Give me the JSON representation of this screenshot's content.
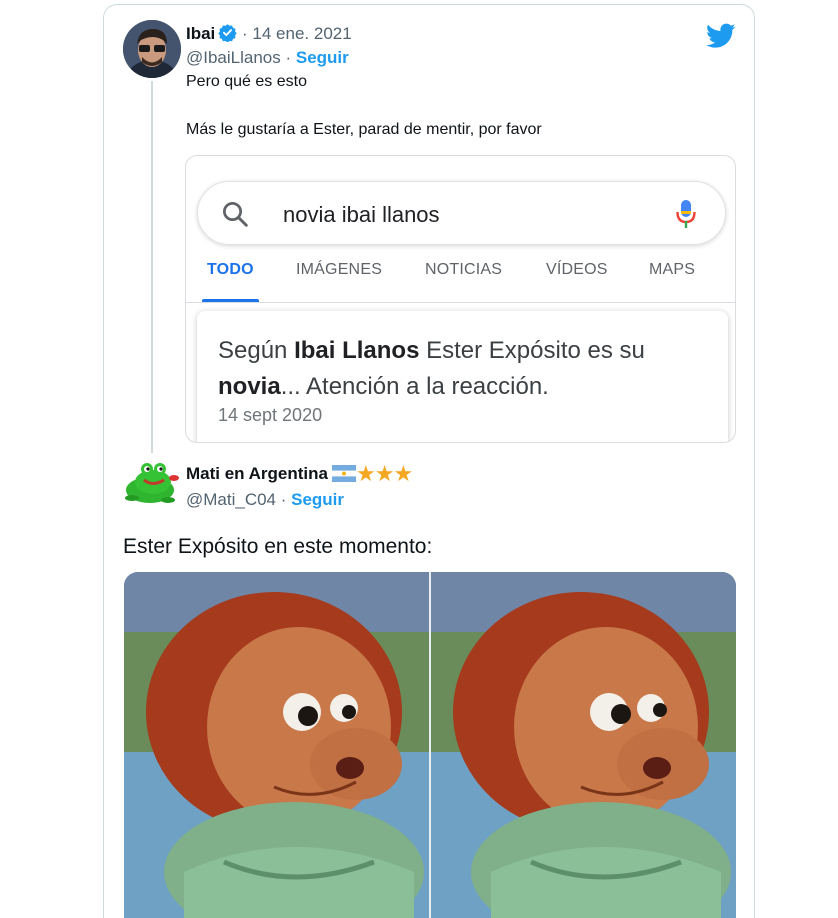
{
  "tweet": {
    "author_name": "Ibai",
    "date": "· 14 ene. 2021",
    "handle": "@IbaiLlanos",
    "separator": " · ",
    "follow_label": "Seguir",
    "text_line1": "Pero qué es esto",
    "text_line2": "Más le gustaría a Ester, parad de mentir, por favor",
    "icons": [
      "verified-icon",
      "twitter-bird-icon"
    ],
    "accent_color": "#1d9bf0"
  },
  "google": {
    "query": "novia ibai llanos",
    "tabs": [
      "TODO",
      "IMÁGENES",
      "NOTICIAS",
      "VÍDEOS",
      "MAPS"
    ],
    "active_tab": "TODO",
    "result": {
      "part1": "Según ",
      "bold1": "Ibai Llanos",
      "part2": " Ester Expósito es su",
      "bold2": "novia",
      "part3": "... Atención a la reacción.",
      "date": "14 sept 2020"
    },
    "icons": [
      "search-icon",
      "microphone-icon"
    ],
    "accent_color": "#1a73e8"
  },
  "reply": {
    "author_name": "Mati en Argentina",
    "stars": "★★★",
    "handle": "@Mati_C04",
    "separator": " · ",
    "follow_label": "Seguir",
    "text": "Ester Expósito en este momento:",
    "icons": [
      "argentina-flag-icon",
      "frog-avatar-icon"
    ]
  }
}
